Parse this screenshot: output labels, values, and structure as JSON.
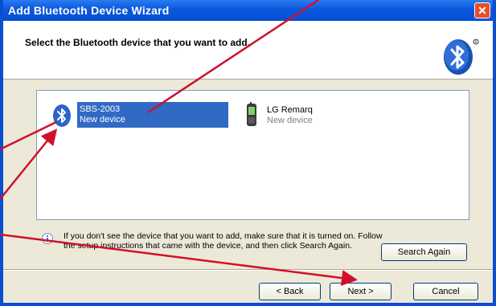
{
  "window": {
    "title": "Add Bluetooth Device Wizard",
    "close_glyph": "✕"
  },
  "header": {
    "text": "Select the Bluetooth device that you want to add.",
    "logo_icon": "bluetooth-logo-icon"
  },
  "devices": [
    {
      "name": "SBS-2003",
      "status": "New device",
      "icon": "bluetooth-icon",
      "selected": true
    },
    {
      "name": "LG Remarq",
      "status": "New device",
      "icon": "phone-icon",
      "selected": false
    }
  ],
  "info": {
    "icon": "info-icon",
    "text": "If you don't see the device that you want to add, make sure that it is turned on. Follow the setup instructions that came with the device, and then click Search Again."
  },
  "buttons": {
    "search_again": "Search Again",
    "back": "< Back",
    "next": "Next >",
    "cancel": "Cancel"
  },
  "colors": {
    "annotation_arrow": "#d0102a",
    "selection": "#316ac5",
    "titlebar": "#0a57de"
  }
}
